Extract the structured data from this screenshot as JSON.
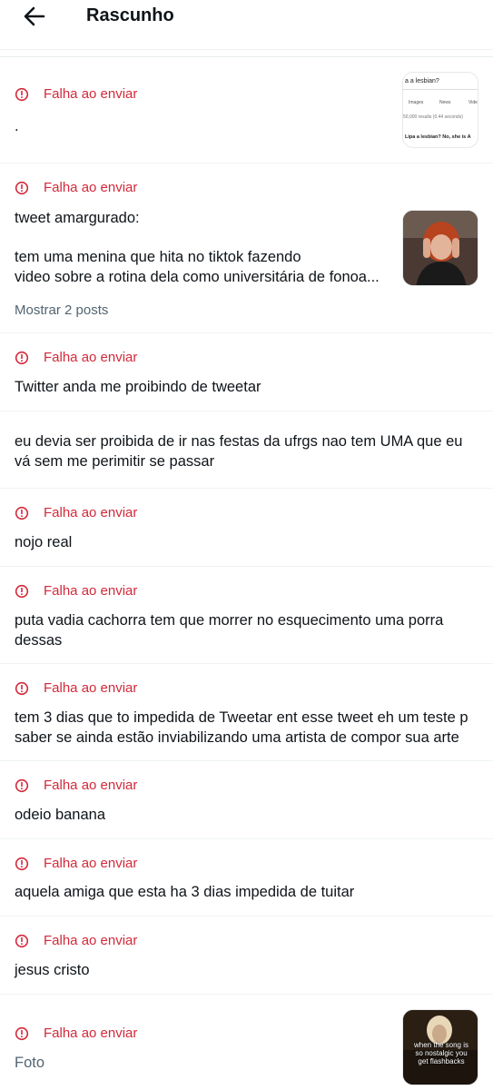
{
  "header": {
    "title": "Rascunho",
    "back_icon": "arrow-left-icon"
  },
  "status": {
    "fail_label": "Falha ao enviar",
    "fail_icon": "alert-circle-icon",
    "fail_color": "#d3293a"
  },
  "drafts": [
    {
      "failed": true,
      "text": ".",
      "thumbnail": {
        "type": "search-screenshot",
        "query": "a a lesbian?",
        "tabs": [
          "Images",
          "News",
          "Vide"
        ],
        "results": "50,000 results (0.44 seconds)",
        "answer": "Lipa a lesbian? No, she is A"
      }
    },
    {
      "failed": true,
      "lines": [
        "tweet amargurado:",
        "",
        "tem uma menina que hita no tiktok fazendo",
        "video sobre a rotina dela como universitária de fonoa..."
      ],
      "show_more": "Mostrar 2 posts",
      "thumbnail": {
        "type": "photo"
      }
    },
    {
      "failed": true,
      "text": "Twitter anda me proibindo de tweetar"
    },
    {
      "failed": false,
      "lines": [
        "eu devia ser proibida de ir nas festas da ufrgs nao tem UMA que eu",
        "vá sem me perimitir se passar"
      ]
    },
    {
      "failed": true,
      "text": "nojo real"
    },
    {
      "failed": true,
      "lines": [
        "puta vadia cachorra tem que morrer no esquecimento uma porra",
        "dessas"
      ]
    },
    {
      "failed": true,
      "lines": [
        "tem 3 dias que to impedida de Tweetar ent esse tweet eh um teste p",
        "saber se ainda estão inviabilizando uma artista de compor sua arte"
      ]
    },
    {
      "failed": true,
      "text": "odeio banana"
    },
    {
      "failed": true,
      "text": "aquela amiga que esta ha 3 dias impedida de tuitar"
    },
    {
      "failed": true,
      "text": "jesus cristo"
    },
    {
      "failed": true,
      "text": "Foto",
      "thumbnail": {
        "type": "meme",
        "caption": "when the song is so nostalgic you get flashbacks"
      }
    }
  ]
}
